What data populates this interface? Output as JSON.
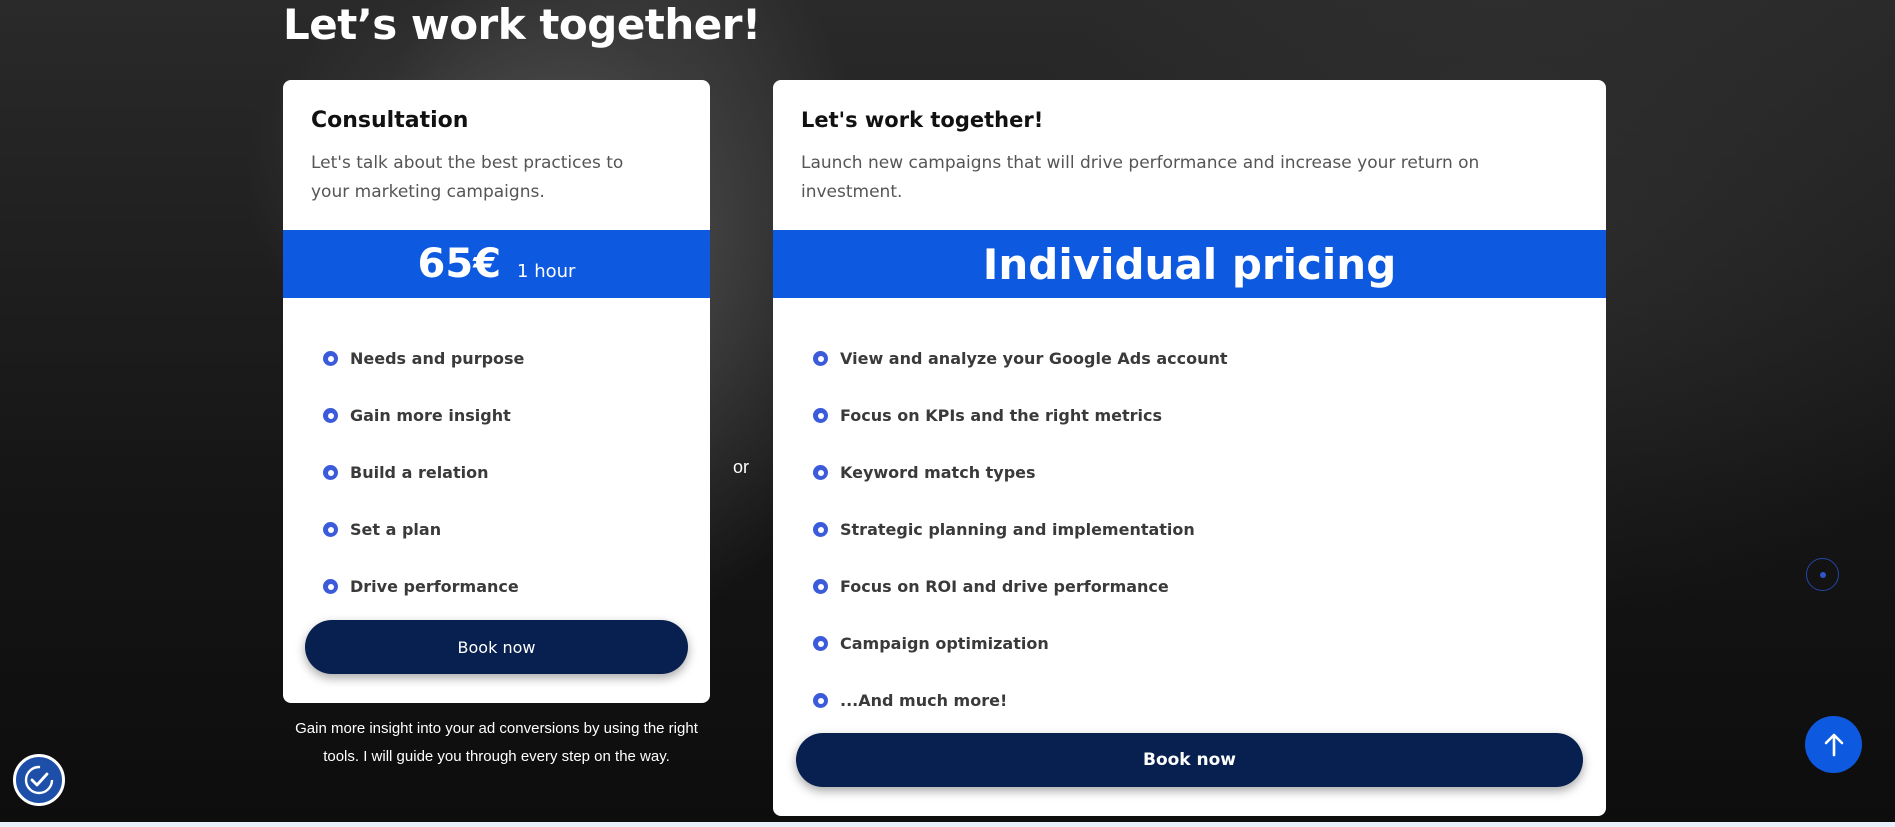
{
  "page": {
    "title": "Let’s work together!"
  },
  "consultation": {
    "title": "Consultation",
    "description": "Let's talk about the best practices to your marketing campaigns.",
    "price": "65€",
    "price_unit": "1 hour",
    "features": [
      "Needs and purpose",
      "Gain more insight",
      "Build a relation",
      "Set a plan",
      "Drive performance"
    ],
    "button_label": "Book now",
    "note": "Gain more insight into your ad conversions by using the right tools. I will guide you through every step on the way."
  },
  "separator": {
    "label": "or"
  },
  "collaboration": {
    "title": "Let's work together!",
    "description": "Launch new campaigns that will drive performance and increase your return on investment.",
    "pricing_label": "Individual pricing",
    "features": [
      "View and analyze your Google Ads account",
      "Focus on KPIs and the right metrics",
      "Keyword match types",
      "Strategic planning and implementation",
      "Focus on ROI and drive performance",
      "Campaign optimization",
      "...And much more!"
    ],
    "button_label": "Book now"
  },
  "widgets": {
    "back_to_top_icon": "arrow-up-icon",
    "accessibility_icon": "accessibility-check-icon",
    "scroll_indicator_icon": "scroll-dot-icon"
  },
  "colors": {
    "accent_blue": "#0d5ae0",
    "button_navy": "#07204f",
    "bullet_blue": "#3b5bdb"
  }
}
